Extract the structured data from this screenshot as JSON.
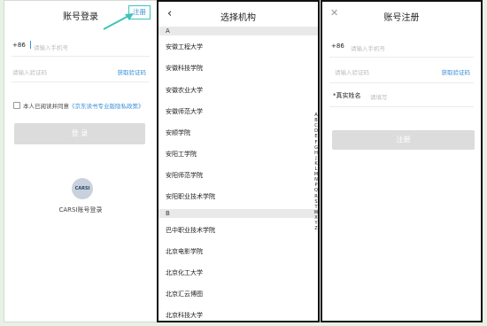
{
  "login": {
    "title": "账号登录",
    "register_link": "注册",
    "country_code": "+86",
    "phone_placeholder": "请输入手机号",
    "code_placeholder": "请输入验证码",
    "get_code": "获取验证码",
    "agree_prefix": "本人已阅读并同意",
    "policy": "《京东读书专业版隐私政策》",
    "login_button": "登 录",
    "carsi_logo_text": "CARSI",
    "carsi_label": "CARSI账号登录"
  },
  "institution": {
    "title": "选择机构",
    "sections": [
      {
        "letter": "A",
        "items": [
          "安徽工程大学",
          "安徽科技学院",
          "安徽农业大学",
          "安徽师范大学",
          "安顺学院",
          "安阳工学院",
          "安阳师范学院",
          "安阳职业技术学院"
        ]
      },
      {
        "letter": "B",
        "items": [
          "巴中职业技术学院",
          "北京电影学院",
          "北京化工大学",
          "北京汇云博图",
          "北京科技大学"
        ]
      }
    ],
    "index": [
      "A",
      "B",
      "C",
      "D",
      "E",
      "F",
      "G",
      "H",
      "J",
      "K",
      "L",
      "M",
      "N",
      "P",
      "Q",
      "R",
      "S",
      "T",
      "W",
      "X",
      "Y",
      "Z"
    ]
  },
  "register": {
    "title": "账号注册",
    "country_code": "+86",
    "phone_placeholder": "请输入手机号",
    "code_placeholder": "请输入验证码",
    "get_code": "获取验证码",
    "name_label": "*真实姓名",
    "name_placeholder": "请填写",
    "register_button": "注册"
  }
}
